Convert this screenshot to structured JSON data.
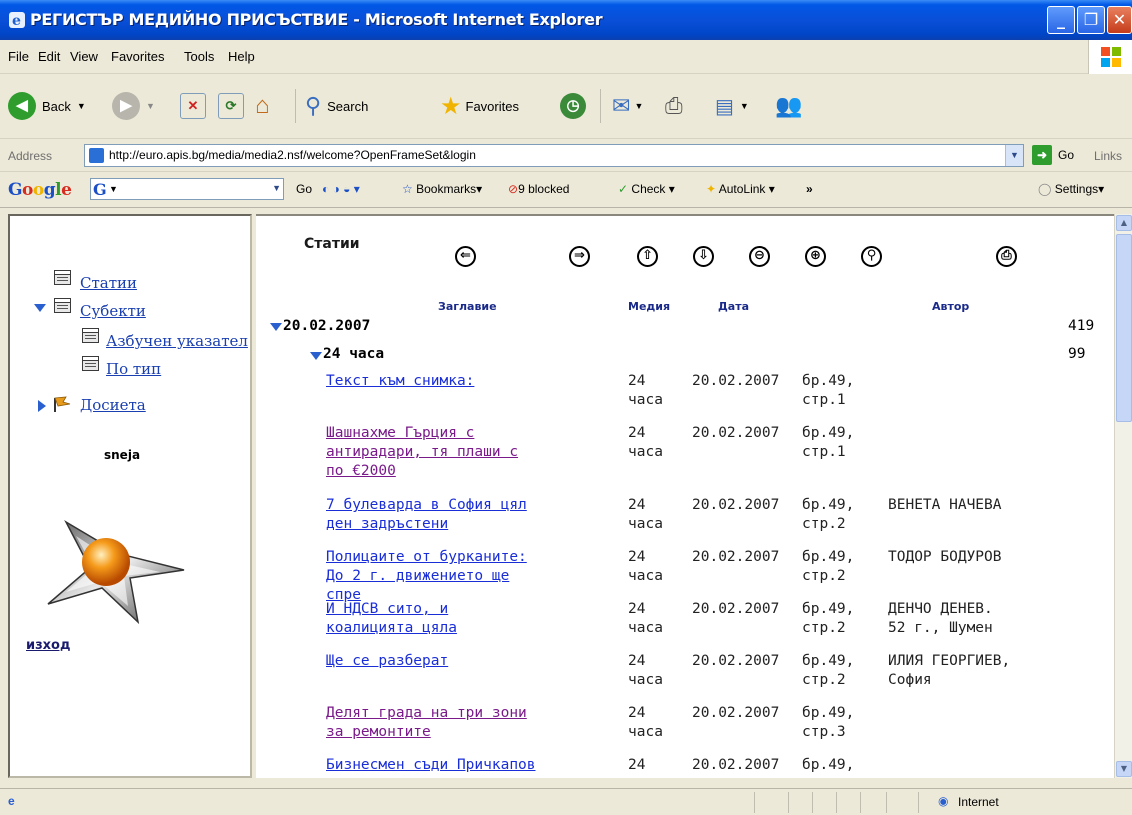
{
  "window": {
    "title": "РЕГИСТЪР МЕДИЙНО ПРИСЪСТВИЕ - Microsoft Internet Explorer"
  },
  "menu": [
    "File",
    "Edit",
    "View",
    "Favorites",
    "Tools",
    "Help"
  ],
  "toolbar": {
    "back": "Back",
    "search": "Search",
    "favorites": "Favorites"
  },
  "address": {
    "label": "Address",
    "url": "http://euro.apis.bg/media/media2.nsf/welcome?OpenFrameSet&login",
    "go": "Go",
    "links": "Links"
  },
  "google": {
    "logo": "Google",
    "go": "Go",
    "bookmarks": "Bookmarks",
    "blocked": "9 blocked",
    "check": "Check",
    "autolink": "AutoLink",
    "more": "»",
    "settings": "Settings"
  },
  "left": {
    "nav": [
      "Статии",
      "Субекти",
      "Азбучен указател",
      "По тип",
      "Досиета"
    ],
    "user": "sneja",
    "exit": "изход"
  },
  "content": {
    "heading": "Статии",
    "nav_icons": [
      "back-icon",
      "forward-icon",
      "up-icon",
      "down-icon",
      "collapse-icon",
      "expand-icon",
      "search-icon",
      "print-icon"
    ],
    "columns": [
      "Заглавие",
      "Медия",
      "Дата",
      "Автор"
    ],
    "date_group": {
      "label": "20.02.2007",
      "count": "419"
    },
    "media_group": {
      "label": "24 часа",
      "count": "99"
    },
    "rows": [
      {
        "title": "Текст към снимка:",
        "media": "24 часа",
        "date": "20.02.2007",
        "issue": "бр.49, стр.1",
        "author": "",
        "visited": false
      },
      {
        "title": "Шашнахме Гърция с антирадари, тя плаши с по €2000",
        "media": "24 часа",
        "date": "20.02.2007",
        "issue": "бр.49, стр.1",
        "author": "",
        "visited": true
      },
      {
        "title": "7 булеварда в София цял ден задръстени",
        "media": "24 часа",
        "date": "20.02.2007",
        "issue": "бр.49, стр.2",
        "author": "ВЕНЕТА НАЧЕВА",
        "visited": false
      },
      {
        "title": "Полицаите от бурканите: До 2 г. движението ще спре",
        "media": "24 часа",
        "date": "20.02.2007",
        "issue": "бр.49, стр.2",
        "author": "ТОДОР БОДУРОВ",
        "visited": false
      },
      {
        "title": "И НДСВ сито, и коалицията цяла",
        "media": "24 часа",
        "date": "20.02.2007",
        "issue": "бр.49, стр.2",
        "author": "ДЕНЧО ДЕНЕВ. 52 г., Шумен",
        "visited": false
      },
      {
        "title": "Ще се разберат",
        "media": "24 часа",
        "date": "20.02.2007",
        "issue": "бр.49, стр.2",
        "author": "ИЛИЯ ГЕОРГИЕВ, София",
        "visited": false
      },
      {
        "title": "Делят града на три зони за ремонтите",
        "media": "24 часа",
        "date": "20.02.2007",
        "issue": "бр.49, стр.3",
        "author": "",
        "visited": true
      },
      {
        "title": "Бизнесмен съди Причкапов",
        "media": "24",
        "date": "20.02.2007",
        "issue": "бр.49,",
        "author": "",
        "visited": false
      }
    ]
  },
  "status": {
    "zone": "Internet"
  }
}
